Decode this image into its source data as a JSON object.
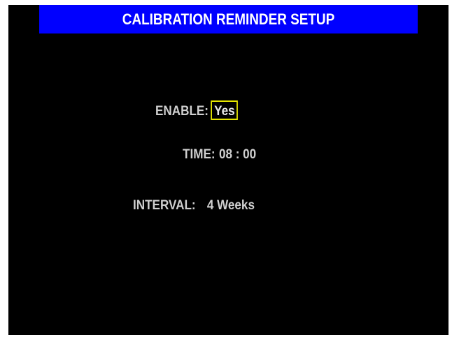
{
  "header": {
    "title": "CALIBRATION REMINDER SETUP"
  },
  "settings": {
    "enable": {
      "label": "ENABLE:",
      "value": "Yes"
    },
    "time": {
      "label": "TIME:",
      "value": "08 : 00"
    },
    "interval": {
      "label": "INTERVAL:",
      "value": "4 Weeks"
    }
  },
  "colors": {
    "title_bar": "#0000ff",
    "screen_background": "#000000",
    "text": "#d0d0d0",
    "focus_border": "#e6e600"
  }
}
